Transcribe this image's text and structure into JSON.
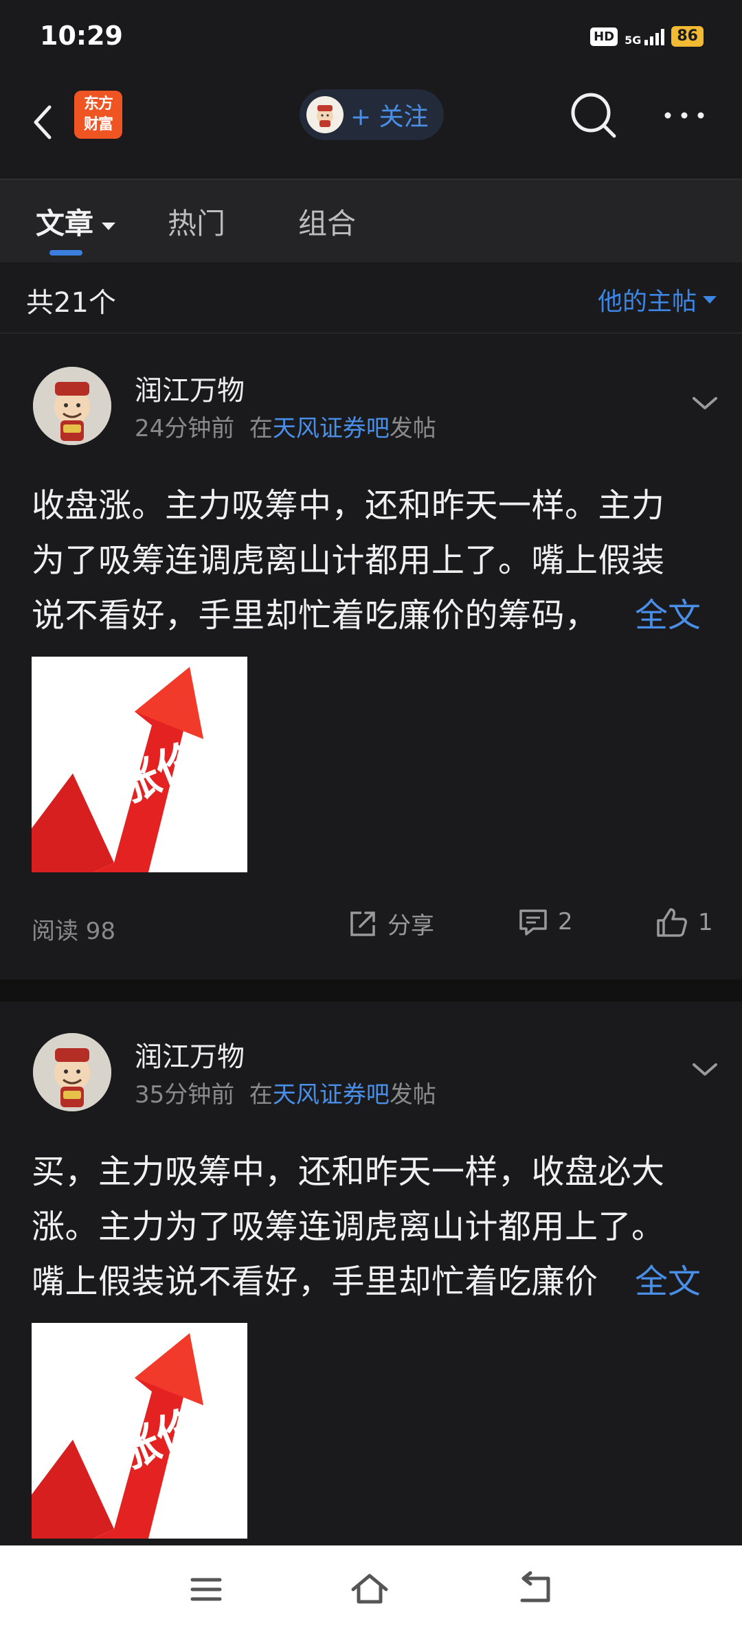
{
  "status_bar": {
    "time": "10:29",
    "hd": "HD",
    "network": "5G",
    "battery": "86"
  },
  "nav": {
    "logo_line1": "东方",
    "logo_line2": "财富",
    "follow_label": "+ 关注"
  },
  "tabs": [
    {
      "label": "文章",
      "active": true
    },
    {
      "label": "热门",
      "active": false
    },
    {
      "label": "组合",
      "active": false
    }
  ],
  "summary": {
    "count": "共21个",
    "filter": "他的主帖"
  },
  "posts": [
    {
      "author": "润江万物",
      "time": "24分钟前",
      "in_label": "在",
      "bar": "天风证券吧",
      "posted": "发帖",
      "lines": [
        "收盘涨。主力吸筹中，还和昨天一样。主力",
        "为了吸筹连调虎离山计都用上了。嘴上假装",
        "说不看好，手里却忙着吃廉价的筹码，"
      ],
      "fulltext": "全文",
      "image_text": "涨价",
      "read": "阅读 98",
      "share": "分享",
      "comments": "2",
      "likes": "1"
    },
    {
      "author": "润江万物",
      "time": "35分钟前",
      "in_label": "在",
      "bar": "天风证券吧",
      "posted": "发帖",
      "lines": [
        "买，主力吸筹中，还和昨天一样，收盘必大",
        "涨。主力为了吸筹连调虎离山计都用上了。",
        "嘴上假装说不看好，手里却忙着吃廉价"
      ],
      "fulltext": "全文",
      "image_text": "涨价"
    }
  ],
  "colors": {
    "accent": "#3b7fde",
    "link": "#4a8fe7",
    "background": "#1a1a1c",
    "logo": "#ee5522",
    "battery": "#f2b933"
  }
}
